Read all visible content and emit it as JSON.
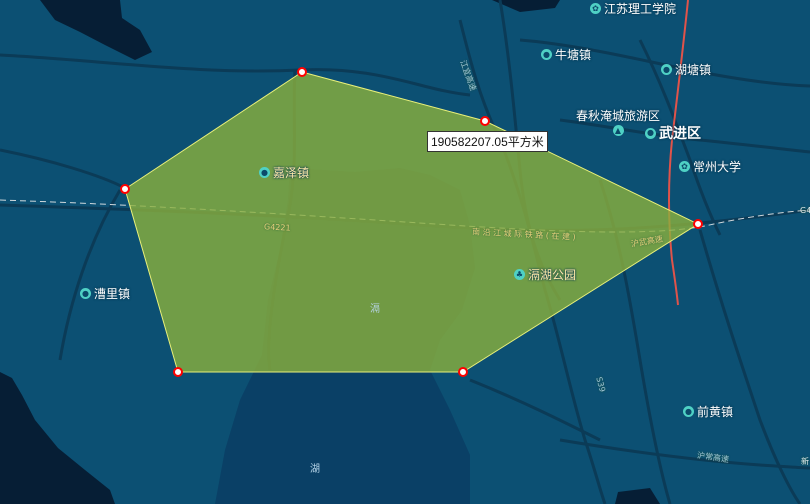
{
  "map": {
    "colors": {
      "land": "#0c5073",
      "lake": "#0a4066",
      "coast": "#061e35",
      "road": "#0b3b57",
      "expressway": "#e0534a",
      "polygon_fill": "#8bb03c",
      "polygon_stroke": "#e9f07a",
      "vertex_fill": "#ffffff",
      "vertex_stroke": "#ff0000"
    },
    "measurement": {
      "area_label": "190582207.05平方米"
    },
    "places": [
      {
        "name": "江苏理工学院",
        "icon": "university-icon",
        "glyph": "✿"
      },
      {
        "name": "牛塘镇",
        "icon": "town-icon",
        "glyph": "●"
      },
      {
        "name": "湖塘镇",
        "icon": "town-icon",
        "glyph": "●"
      },
      {
        "name": "春秋淹城旅游区",
        "icon": "scenic-area-icon",
        "glyph": "▲"
      },
      {
        "name": "武进区",
        "icon": "district-icon",
        "glyph": "●"
      },
      {
        "name": "常州大学",
        "icon": "university-icon",
        "glyph": "✿"
      },
      {
        "name": "嘉泽镇",
        "icon": "town-icon",
        "glyph": "●"
      },
      {
        "name": "滆湖公园",
        "icon": "park-icon",
        "glyph": "♣"
      },
      {
        "name": "漕里镇",
        "icon": "town-icon",
        "glyph": "●"
      },
      {
        "name": "前黄镇",
        "icon": "town-icon",
        "glyph": "●"
      }
    ],
    "road_labels": [
      "G4221",
      "南 沿 江 城 际 铁 路 ( 在 建 )",
      "沪武高速",
      "江宜高速",
      "S39",
      "沪常高速"
    ],
    "water_labels": [
      "滆",
      "湖"
    ],
    "partial_labels": [
      "G4",
      "新"
    ]
  }
}
